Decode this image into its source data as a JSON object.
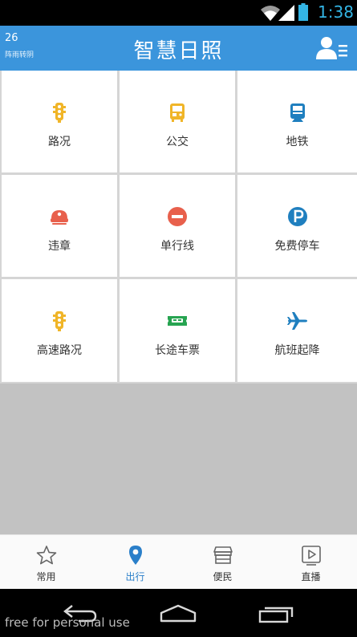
{
  "status_bar": {
    "time": "1:38"
  },
  "header": {
    "weather_temp": "26",
    "weather_desc": "阵雨转阴",
    "title": "智慧日照"
  },
  "grid": [
    {
      "label": "路况",
      "icon": "traffic-light-icon"
    },
    {
      "label": "公交",
      "icon": "bus-icon"
    },
    {
      "label": "地铁",
      "icon": "subway-icon"
    },
    {
      "label": "违章",
      "icon": "police-cap-icon"
    },
    {
      "label": "单行线",
      "icon": "no-entry-icon"
    },
    {
      "label": "免费停车",
      "icon": "parking-icon"
    },
    {
      "label": "高速路况",
      "icon": "traffic-light-icon"
    },
    {
      "label": "长途车票",
      "icon": "bus-ticket-icon"
    },
    {
      "label": "航班起降",
      "icon": "airplane-icon"
    }
  ],
  "bottom_nav": [
    {
      "label": "常用",
      "icon": "star-icon",
      "active": false
    },
    {
      "label": "出行",
      "icon": "location-pin-icon",
      "active": true
    },
    {
      "label": "便民",
      "icon": "shop-icon",
      "active": false
    },
    {
      "label": "直播",
      "icon": "play-icon",
      "active": false
    }
  ],
  "watermark": "free for personal use",
  "colors": {
    "header": "#3b95dc",
    "icon_yellow": "#f0b528",
    "icon_blue": "#1f7fbf",
    "icon_red": "#e8604c",
    "icon_green": "#27a451",
    "nav_active": "#2a7fc9"
  }
}
